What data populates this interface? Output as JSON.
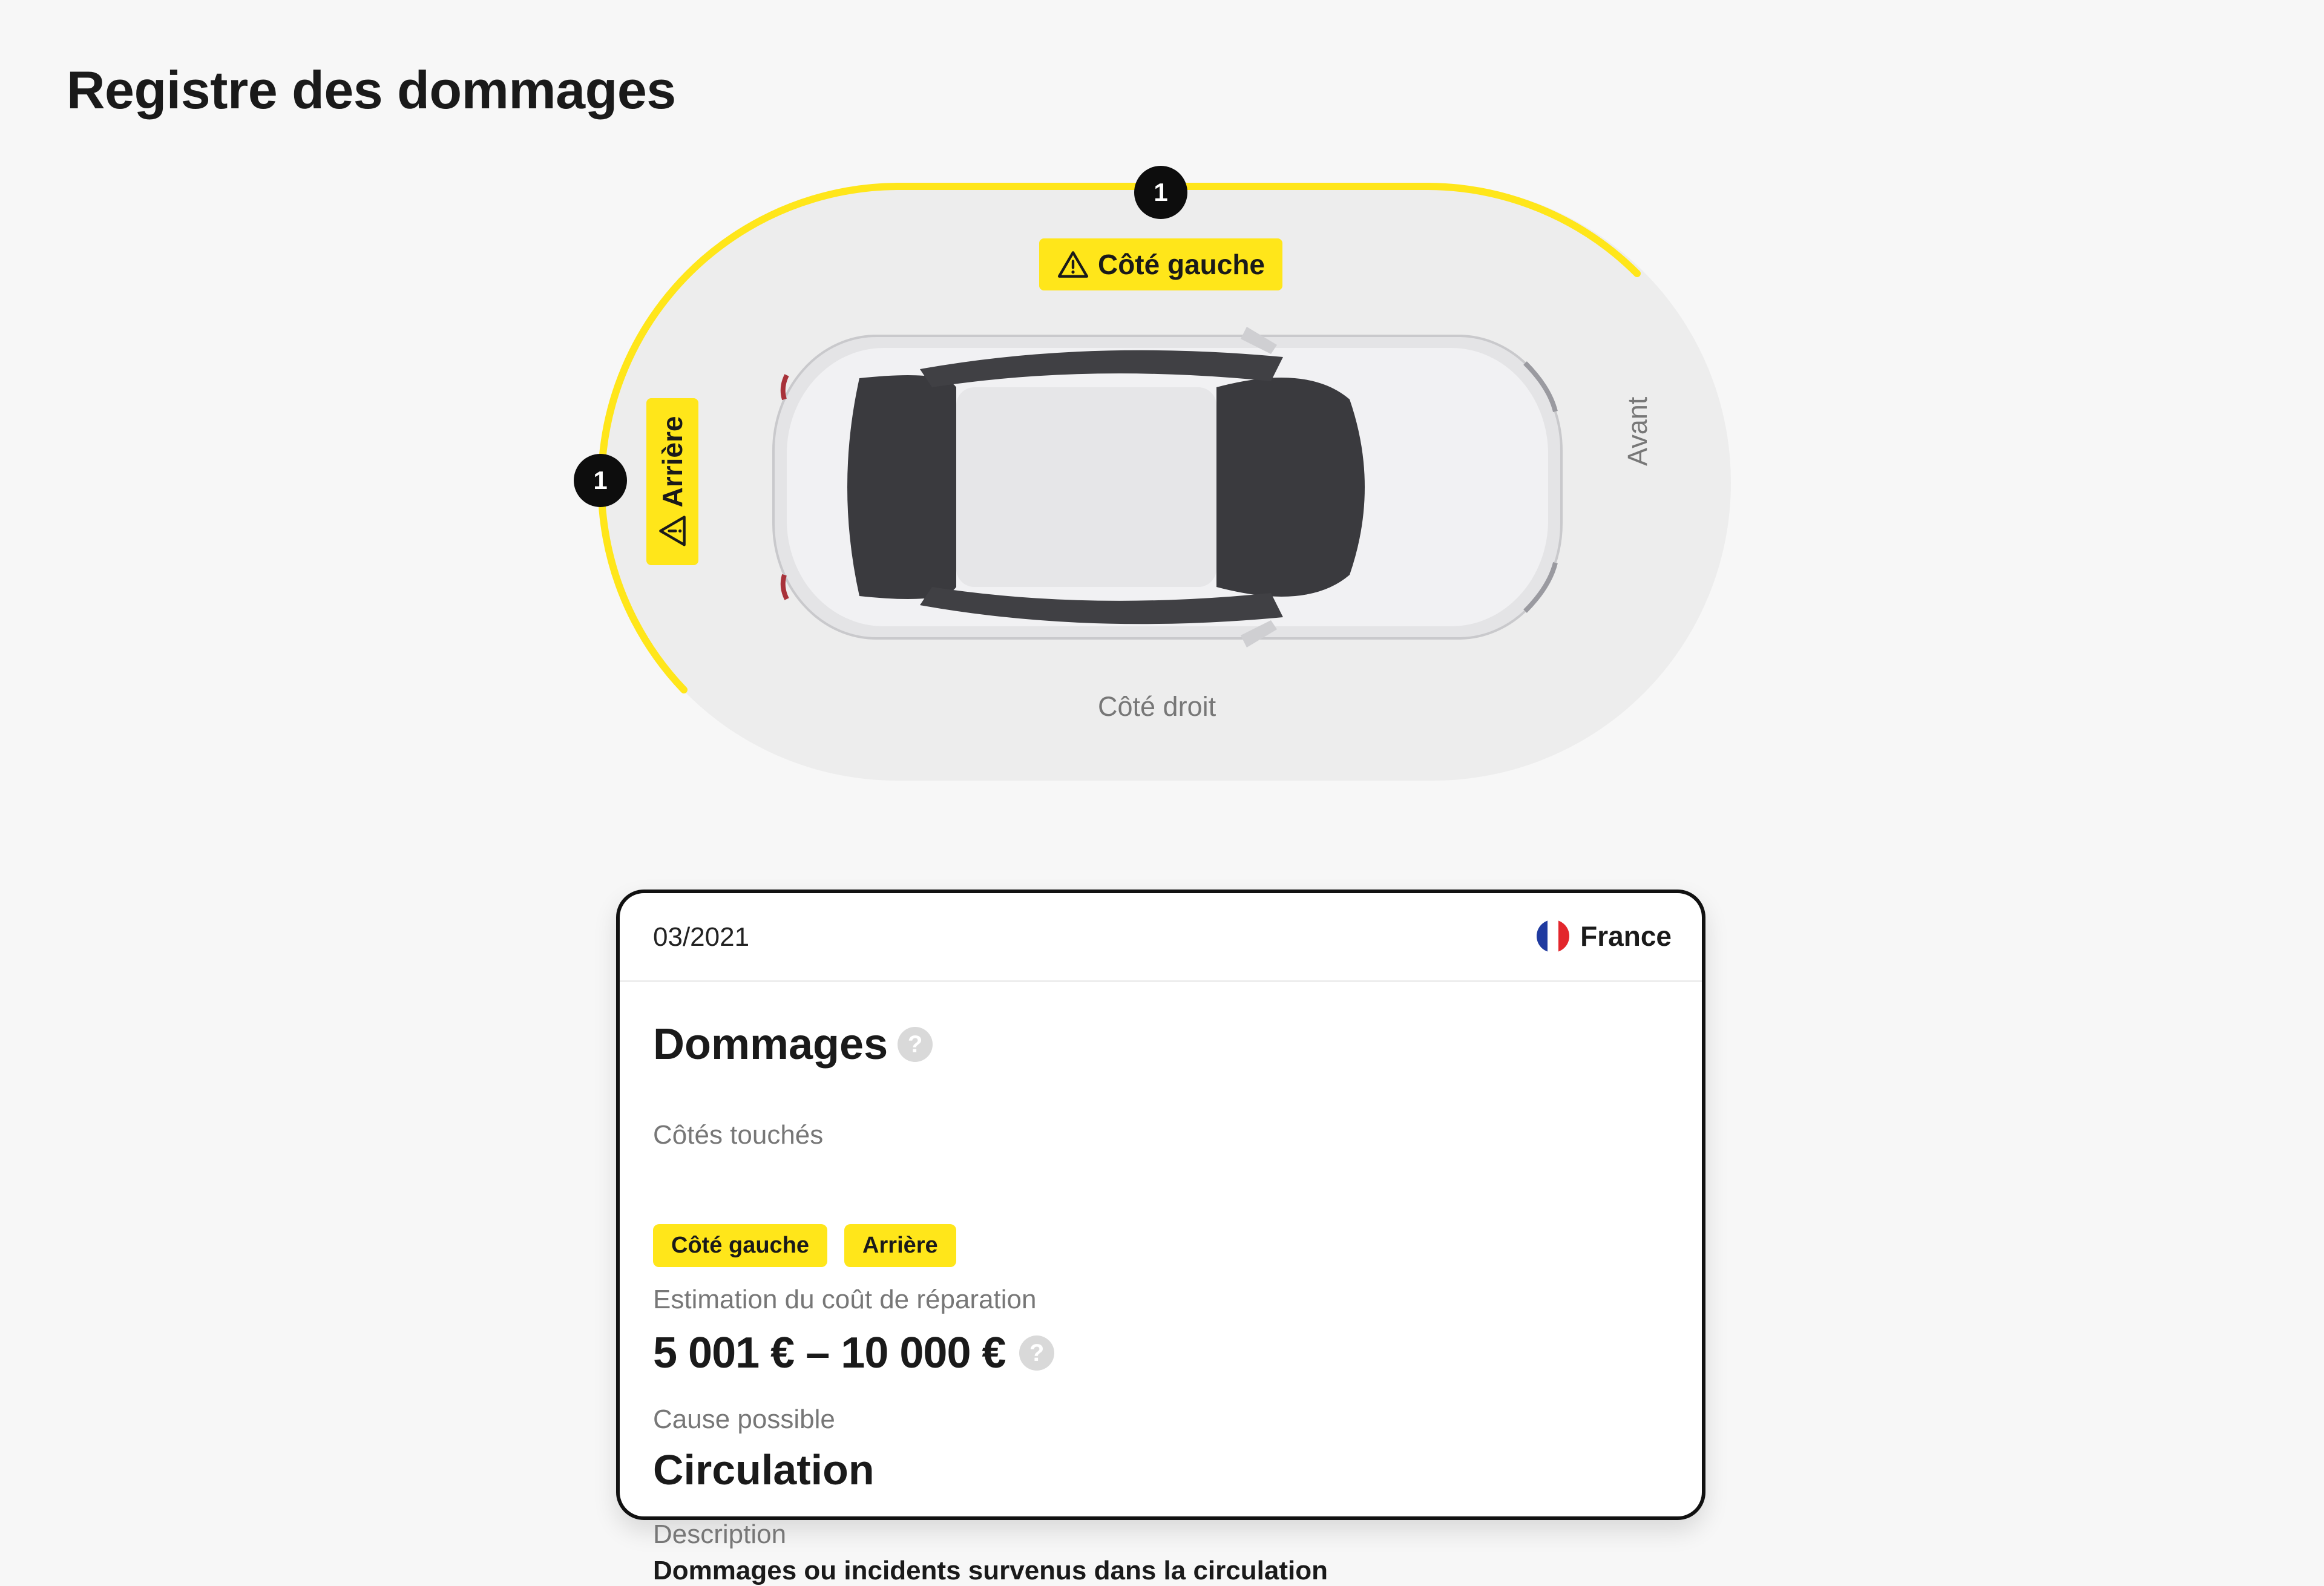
{
  "page": {
    "title": "Registre des dommages"
  },
  "diagram": {
    "labels": {
      "right_side": "Côté droit",
      "front": "Avant"
    },
    "zones": [
      {
        "name": "Côté gauche",
        "count": "1",
        "icon": "warning-icon"
      },
      {
        "name": "Arrière",
        "count": "1",
        "icon": "warning-icon"
      }
    ],
    "colors": {
      "accent": "#ffe61a",
      "badge": "#0d0d0d",
      "track": "#ededed"
    }
  },
  "card": {
    "date": "03/2021",
    "country": "France",
    "flag_colors": [
      "#1f3aa0",
      "#ffffff",
      "#e3262c"
    ],
    "section_title": "Dommages",
    "help_glyph": "?",
    "sides_label": "Côtés touchés",
    "sides": [
      "Côté gauche",
      "Arrière"
    ],
    "cost_label": "Estimation du coût de réparation",
    "cost_value": "5 001 € – 10 000 €",
    "cause_label": "Cause possible",
    "cause_value": "Circulation",
    "description_label": "Description",
    "description_value": "Dommages ou incidents survenus dans la circulation"
  }
}
